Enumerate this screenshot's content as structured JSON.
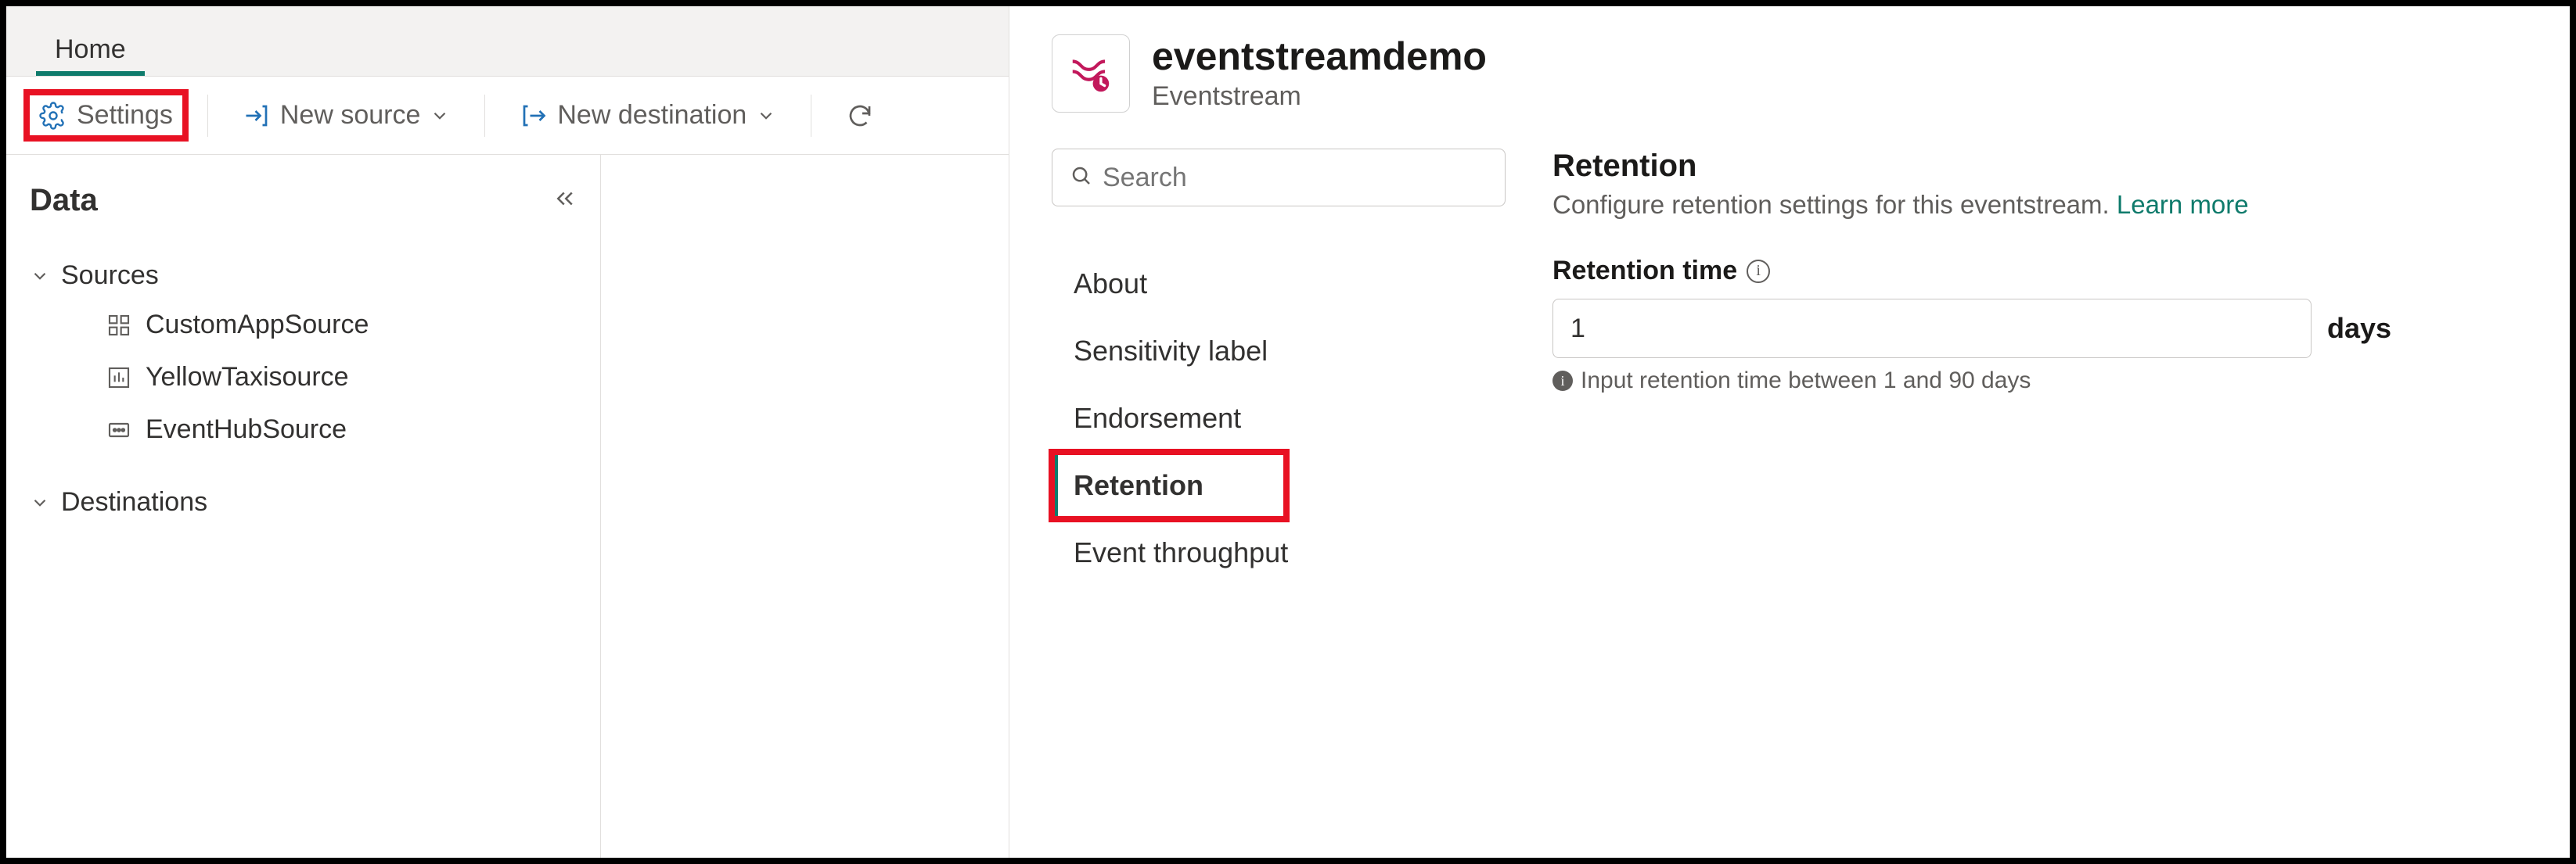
{
  "ribbon": {
    "tabs": [
      {
        "label": "Home",
        "active": true
      }
    ]
  },
  "toolbar": {
    "settings_label": "Settings",
    "new_source_label": "New source",
    "new_destination_label": "New destination"
  },
  "data_panel": {
    "title": "Data",
    "sources_label": "Sources",
    "destinations_label": "Destinations",
    "sources": [
      {
        "label": "CustomAppSource",
        "icon": "app"
      },
      {
        "label": "YellowTaxisource",
        "icon": "chart"
      },
      {
        "label": "EventHubSource",
        "icon": "hub"
      }
    ]
  },
  "settings": {
    "entity_title": "eventstreamdemo",
    "entity_type": "Eventstream",
    "search_placeholder": "Search",
    "nav": [
      {
        "label": "About",
        "selected": false
      },
      {
        "label": "Sensitivity label",
        "selected": false
      },
      {
        "label": "Endorsement",
        "selected": false
      },
      {
        "label": "Retention",
        "selected": true
      },
      {
        "label": "Event throughput",
        "selected": false
      }
    ],
    "retention": {
      "title": "Retention",
      "description": "Configure retention settings for this eventstream.",
      "learn_more": "Learn more",
      "field_label": "Retention time",
      "value": "1",
      "unit": "days",
      "hint": "Input retention time between 1 and 90 days"
    }
  }
}
